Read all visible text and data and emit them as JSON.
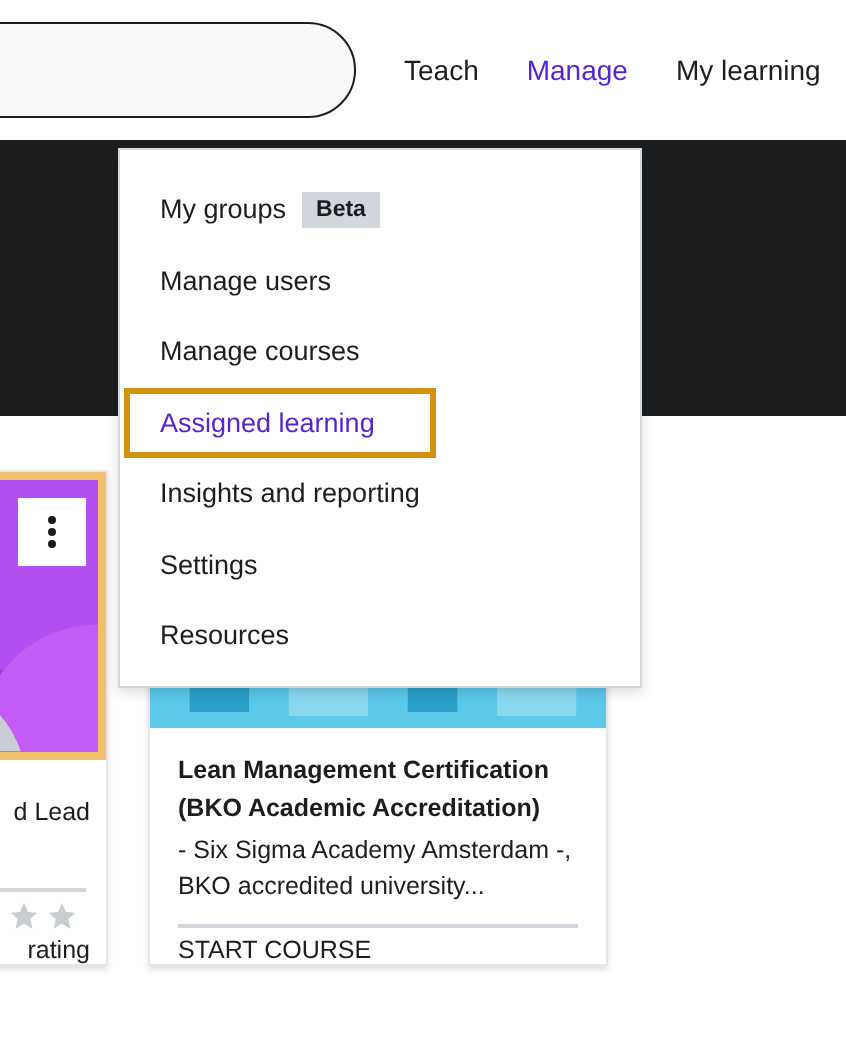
{
  "nav": [
    {
      "label": "Teach",
      "selected": false
    },
    {
      "label": "Manage",
      "selected": true
    },
    {
      "label": "My learning",
      "selected": false
    }
  ],
  "menu": {
    "items": [
      {
        "label": "My groups",
        "badge": "Beta",
        "selected": false
      },
      {
        "label": "Manage users",
        "selected": false
      },
      {
        "label": "Manage courses",
        "selected": false
      },
      {
        "label": "Assigned learning",
        "selected": true
      },
      {
        "label": "Insights and reporting",
        "selected": false
      },
      {
        "label": "Settings",
        "selected": false
      },
      {
        "label": "Resources",
        "selected": false
      }
    ]
  },
  "cards": [
    {
      "kind": "partial",
      "title_tail": "d Lead",
      "rating_tail": "rating",
      "focused": true
    },
    {
      "kind": "full",
      "title": "Lean Management Certification (BKO Academic Accreditation)",
      "description": "- Six Sigma Academy Amsterdam -, BKO accredited university...",
      "action": "START COURSE",
      "focused": false
    }
  ]
}
